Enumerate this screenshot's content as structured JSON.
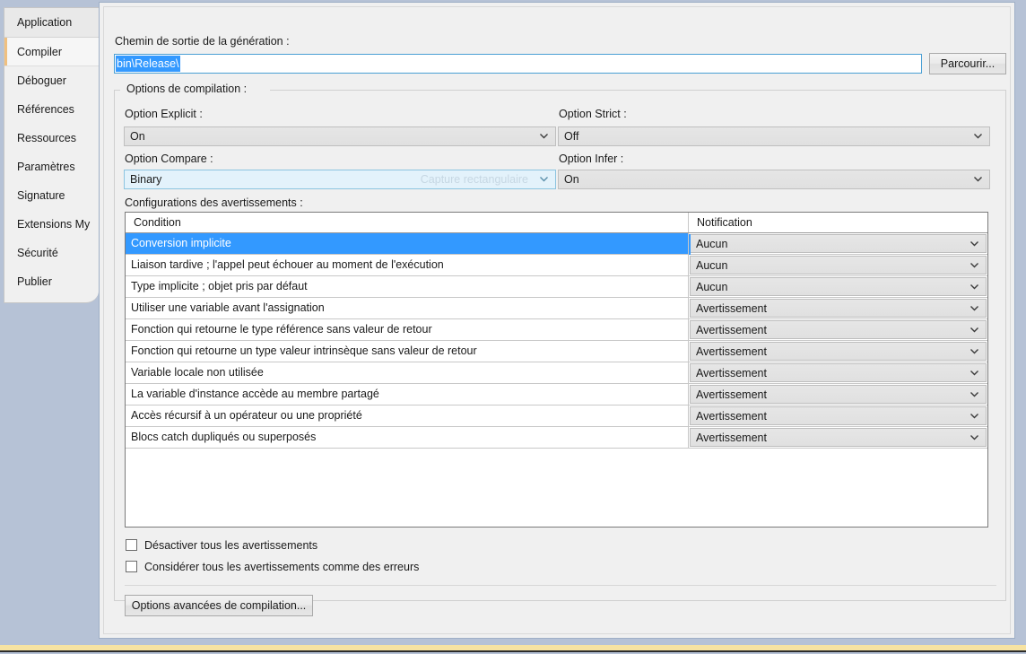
{
  "sidebar": {
    "items": [
      {
        "label": "Application",
        "selected": false
      },
      {
        "label": "Compiler",
        "selected": true
      },
      {
        "label": "Déboguer",
        "selected": false
      },
      {
        "label": "Références",
        "selected": false
      },
      {
        "label": "Ressources",
        "selected": false
      },
      {
        "label": "Paramètres",
        "selected": false
      },
      {
        "label": "Signature",
        "selected": false
      },
      {
        "label": "Extensions My",
        "selected": false
      },
      {
        "label": "Sécurité",
        "selected": false
      },
      {
        "label": "Publier",
        "selected": false
      }
    ]
  },
  "output_path": {
    "label": "Chemin de sortie de la génération :",
    "value": "bin\\Release\\",
    "selected_text": "bin\\Release\\",
    "browse_label": "Parcourir..."
  },
  "compile_group": {
    "label": "Options de compilation :",
    "option_explicit": {
      "label": "Option Explicit :",
      "value": "On"
    },
    "option_strict": {
      "label": "Option Strict :",
      "value": "Off"
    },
    "option_compare": {
      "label": "Option Compare :",
      "value": "Binary",
      "overlay_text": "Capture rectangulaire"
    },
    "option_infer": {
      "label": "Option Infer :",
      "value": "On"
    }
  },
  "warnings": {
    "label": "Configurations des avertissements :",
    "columns": [
      "Condition",
      "Notification"
    ],
    "rows": [
      {
        "condition": "Conversion implicite",
        "notification": "Aucun",
        "selected": true
      },
      {
        "condition": "Liaison tardive ; l'appel peut échouer au moment de l'exécution",
        "notification": "Aucun",
        "selected": false
      },
      {
        "condition": "Type implicite ; objet pris par défaut",
        "notification": "Aucun",
        "selected": false
      },
      {
        "condition": "Utiliser une variable avant l'assignation",
        "notification": "Avertissement",
        "selected": false
      },
      {
        "condition": "Fonction qui retourne le type référence sans valeur de retour",
        "notification": "Avertissement",
        "selected": false
      },
      {
        "condition": "Fonction qui retourne un type valeur intrinsèque sans valeur de retour",
        "notification": "Avertissement",
        "selected": false
      },
      {
        "condition": "Variable locale non utilisée",
        "notification": "Avertissement",
        "selected": false
      },
      {
        "condition": "La variable d'instance accède au membre partagé",
        "notification": "Avertissement",
        "selected": false
      },
      {
        "condition": "Accès récursif à un opérateur ou une propriété",
        "notification": "Avertissement",
        "selected": false
      },
      {
        "condition": "Blocs catch dupliqués ou superposés",
        "notification": "Avertissement",
        "selected": false
      }
    ]
  },
  "checkboxes": {
    "disable_all": {
      "label": "Désactiver tous les avertissements",
      "checked": false
    },
    "warnings_as_errors": {
      "label": "Considérer tous les avertissements comme des erreurs",
      "checked": false
    }
  },
  "advanced_button": {
    "label": "Options avancées de compilation..."
  },
  "colors": {
    "selection_blue": "#3399ff",
    "tab_accent": "#f0c080",
    "window_bg": "#b6c2d6",
    "bottom_strip": "#f7e3a2"
  }
}
